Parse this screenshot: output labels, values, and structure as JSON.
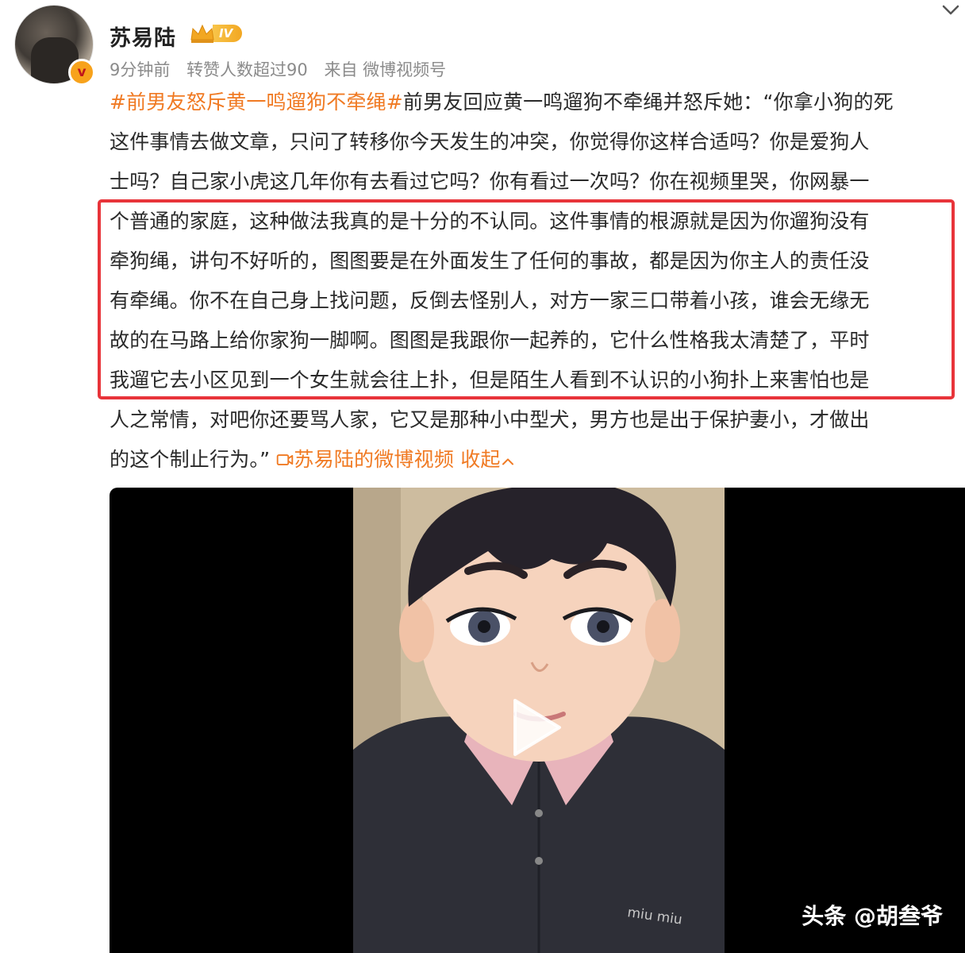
{
  "post": {
    "author_name": "苏易陆",
    "verified_mark": "v",
    "level_badge": "IV",
    "time": "9分钟前",
    "reposts": "转赞人数超过90",
    "source": "来自 微博视频号",
    "lines": [
      {
        "pre": "",
        "tag": "#前男友怒斥黄一鸣遛狗不牵绳#",
        "text": "前男友回应黄一鸣遛狗不牵绳并怒斥她：“你拿小狗的死"
      },
      {
        "text": "这件事情去做文章，只问了转移你今天发生的冲突，你觉得你这样合适吗？你是爱狗人"
      },
      {
        "text": "士吗？自己家小虎这几年你有去看过它吗？你有看过一次吗？你在视频里哭，你网暴一"
      },
      {
        "text": "个普通的家庭，这种做法我真的是十分的不认同。这件事情的根源就是因为你遛狗没有"
      },
      {
        "text": "牵狗绳，讲句不好听的，图图要是在外面发生了任何的事故，都是因为你主人的责任没"
      },
      {
        "text": "有牵绳。你不在自己身上找问题，反倒去怪别人，对方一家三口带着小孩，谁会无缘无"
      },
      {
        "text": "故的在马路上给你家狗一脚啊。图图是我跟你一起养的，它什么性格我太清楚了，平时"
      },
      {
        "text": "我遛它去小区见到一个女生就会往上扑，但是陌生人看到不认识的小狗扑上来害怕也是"
      },
      {
        "text": "人之常情，对吧你还要骂人家，它又是那种小中型犬，男方也是出于保护妻小，才做出"
      }
    ],
    "last_line_text": "的这个制止行为。”",
    "video_link": "苏易陆的微博视频",
    "collapse_label": "收起"
  },
  "video": {
    "shirt_logo": "miu miu",
    "watermark": "头条 @胡叁爷"
  },
  "colors": {
    "accent_orange": "#f07a23",
    "highlight_red": "#e8343a",
    "meta_gray": "#8b8b8b"
  }
}
